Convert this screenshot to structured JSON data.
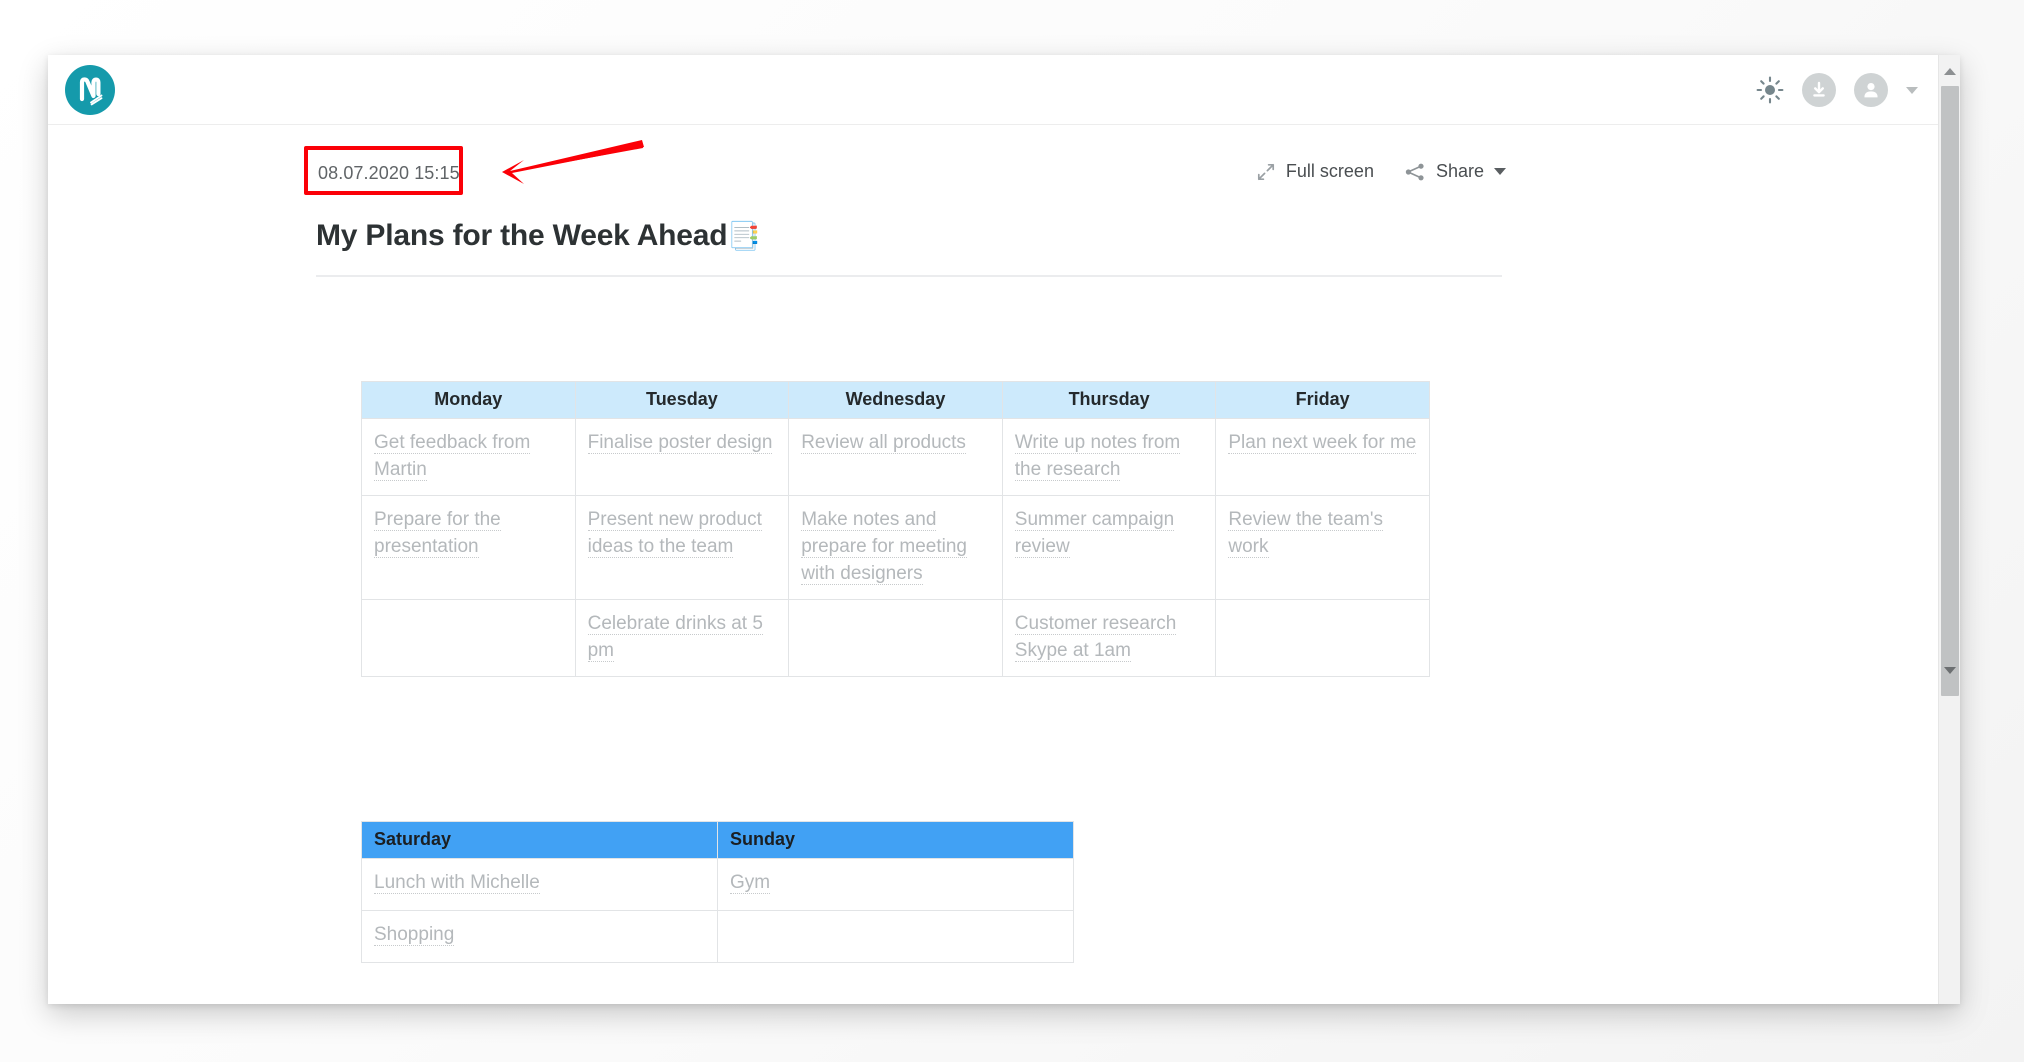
{
  "app": {
    "logo_name": "nimbus-note-logo",
    "accent_color": "#159aab"
  },
  "topbar": {
    "theme_toggle_label": "brightness-icon",
    "download_label": "download-icon",
    "account_label": "account-avatar-icon",
    "account_caret_label": "chevron-down-icon"
  },
  "note": {
    "date": "08.07.2020 15:15",
    "title_text": "My Plans for the Week Ahead",
    "title_emoji": "📑",
    "fullscreen_label": "Full screen",
    "share_label": "Share"
  },
  "annotation": {
    "highlight_color": "#fb0007",
    "highlight_target": "08.07.2020 15:15",
    "arrow_direction": "left"
  },
  "weekday_table": {
    "header_bg": "#cdeafc",
    "headers": [
      "Monday",
      "Tuesday",
      "Wednesday",
      "Thursday",
      "Friday"
    ],
    "rows": [
      [
        "Get feedback from Martin",
        "Finalise poster design",
        "Review all products",
        "Write up notes from the research",
        "Plan next week for me"
      ],
      [
        "Prepare for the presentation",
        "Present new product ideas to the team",
        "Make notes and prepare for meeting with designers",
        "Summer campaign review",
        "Review the team's work"
      ],
      [
        "",
        "Celebrate drinks at 5 pm",
        "",
        "Customer research Skype at 1am",
        ""
      ]
    ]
  },
  "weekend_table": {
    "header_bg": "#41a1f4",
    "headers": [
      "Saturday",
      "Sunday"
    ],
    "rows": [
      [
        "Lunch with Michelle",
        "Gym"
      ],
      [
        "Shopping",
        ""
      ]
    ]
  },
  "scrollbar": {
    "up_arrow": "scroll-up-arrow",
    "down_arrow": "scroll-down-arrow"
  }
}
